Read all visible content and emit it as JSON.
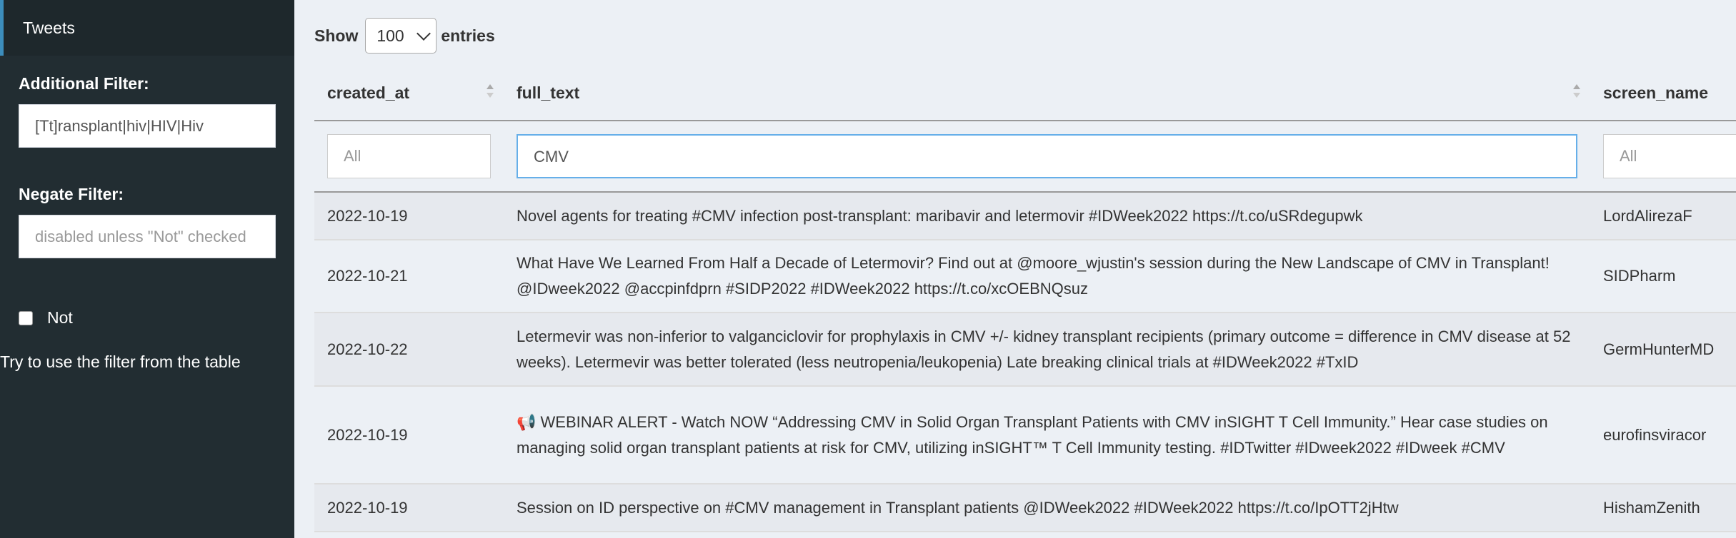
{
  "sidebar": {
    "menu_item": "Tweets",
    "additional_filter": {
      "label": "Additional Filter:",
      "value": "[Tt]ransplant|hiv|HIV|Hiv"
    },
    "negate_filter": {
      "label": "Negate Filter:",
      "placeholder": "disabled unless \"Not\" checked"
    },
    "not_label": "Not",
    "hint": "Try to use the filter from the table"
  },
  "table_controls": {
    "show_label": "Show",
    "page_length": "100",
    "entries_label": "entries"
  },
  "columns": [
    "created_at",
    "full_text",
    "screen_name"
  ],
  "column_filters": [
    "All",
    "CMV",
    "All"
  ],
  "rows": [
    {
      "created_at": "2022-10-19",
      "full_text": "Novel agents for treating #CMV infection post-transplant: maribavir and letermovir #IDWeek2022 https://t.co/uSRdegupwk",
      "screen_name": "LordAlirezaF"
    },
    {
      "created_at": "2022-10-21",
      "full_text": "What Have We Learned From Half a Decade of Letermovir? Find out at @moore_wjustin's session during the New Landscape of CMV in Transplant! @IDweek2022 @accpinfdprn #SIDP2022 #IDWeek2022 https://t.co/xcOEBNQsuz",
      "screen_name": "SIDPharm"
    },
    {
      "created_at": "2022-10-22",
      "full_text": "Letermevir was non-inferior to valganciclovir for prophylaxis in CMV +/- kidney transplant recipients (primary outcome = difference in CMV disease at 52 weeks). Letermevir was better tolerated (less neutropenia/leukopenia) Late breaking clinical trials at #IDWeek2022 #TxID",
      "screen_name": "GermHunterMD"
    },
    {
      "created_at": "2022-10-19",
      "emoji": "📢",
      "full_text": " WEBINAR ALERT - Watch NOW “Addressing CMV in Solid Organ Transplant Patients with CMV inSIGHT T Cell Immunity.” Hear case studies on managing solid organ transplant patients at risk for CMV, utilizing inSIGHT™ T Cell Immunity testing. #IDTwitter #IDweek2022 #IDweek #CMV",
      "screen_name": "eurofinsviracor"
    },
    {
      "created_at": "2022-10-19",
      "full_text": "Session on ID perspective on #CMV management in Transplant patients @IDWeek2022 #IDWeek2022 https://t.co/IpOTT2jHtw",
      "screen_name": "HishamZenith"
    }
  ]
}
